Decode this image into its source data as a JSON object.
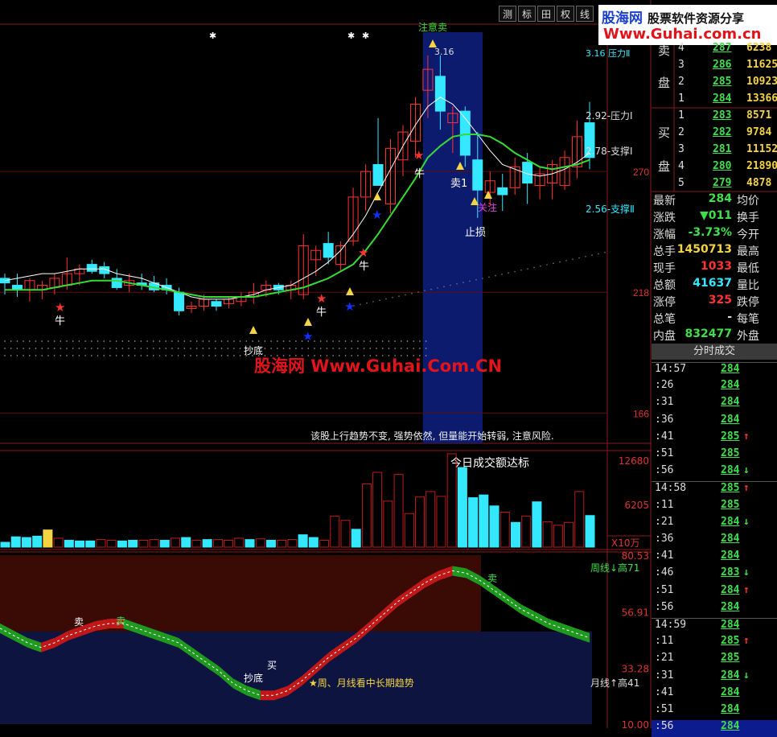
{
  "toolbar": {
    "buttons": [
      "测",
      "标",
      "田",
      "权",
      "线"
    ]
  },
  "watermark": {
    "brand": "股海网",
    "slogan": "股票软件资源分享",
    "url": "Www.Guhai.com.cn",
    "center_text": "股海网 Www.Guhai.Com.CN"
  },
  "colors": {
    "up": "#ff3333",
    "down": "#33e8ff",
    "ma_fast": "#ffffff",
    "ma_slow": "#33dd33",
    "highlight": "#0c1b6e",
    "accent_yellow": "#f4d442",
    "green": "#3ee04a"
  },
  "chart_data": [
    {
      "type": "candlestick",
      "y_ticks": [
        270,
        218,
        166
      ],
      "ylim": [
        155,
        330
      ],
      "candles": [
        {
          "o": 224,
          "h": 226,
          "l": 217,
          "c": 222
        },
        {
          "o": 221,
          "h": 226,
          "l": 216,
          "c": 219
        },
        {
          "o": 219,
          "h": 224,
          "l": 214,
          "c": 223
        },
        {
          "o": 219,
          "h": 223,
          "l": 215,
          "c": 221
        },
        {
          "o": 220,
          "h": 226,
          "l": 217,
          "c": 224
        },
        {
          "o": 221,
          "h": 233,
          "l": 219,
          "c": 226
        },
        {
          "o": 226,
          "h": 230,
          "l": 221,
          "c": 228
        },
        {
          "o": 230,
          "h": 232,
          "l": 226,
          "c": 227
        },
        {
          "o": 229,
          "h": 231,
          "l": 224,
          "c": 226
        },
        {
          "o": 224,
          "h": 228,
          "l": 219,
          "c": 220
        },
        {
          "o": 221,
          "h": 226,
          "l": 218,
          "c": 223
        },
        {
          "o": 222,
          "h": 226,
          "l": 219,
          "c": 221
        },
        {
          "o": 222,
          "h": 225,
          "l": 218,
          "c": 219
        },
        {
          "o": 221,
          "h": 224,
          "l": 217,
          "c": 219
        },
        {
          "o": 218,
          "h": 220,
          "l": 208,
          "c": 210
        },
        {
          "o": 211,
          "h": 214,
          "l": 209,
          "c": 212
        },
        {
          "o": 212,
          "h": 217,
          "l": 210,
          "c": 215
        },
        {
          "o": 214,
          "h": 215,
          "l": 210,
          "c": 212
        },
        {
          "o": 213,
          "h": 216,
          "l": 211,
          "c": 215
        },
        {
          "o": 214,
          "h": 218,
          "l": 212,
          "c": 216
        },
        {
          "o": 216,
          "h": 222,
          "l": 213,
          "c": 218
        },
        {
          "o": 219,
          "h": 223,
          "l": 216,
          "c": 221
        },
        {
          "o": 221,
          "h": 222,
          "l": 217,
          "c": 219
        },
        {
          "o": 219,
          "h": 223,
          "l": 215,
          "c": 221
        },
        {
          "o": 217,
          "h": 243,
          "l": 215,
          "c": 238
        },
        {
          "o": 232,
          "h": 238,
          "l": 225,
          "c": 236
        },
        {
          "o": 239,
          "h": 244,
          "l": 230,
          "c": 233
        },
        {
          "o": 230,
          "h": 240,
          "l": 227,
          "c": 238
        },
        {
          "o": 240,
          "h": 263,
          "l": 238,
          "c": 259
        },
        {
          "o": 259,
          "h": 273,
          "l": 253,
          "c": 270
        },
        {
          "o": 273,
          "h": 293,
          "l": 268,
          "c": 264
        },
        {
          "o": 256,
          "h": 284,
          "l": 252,
          "c": 280
        },
        {
          "o": 275,
          "h": 290,
          "l": 268,
          "c": 287
        },
        {
          "o": 283,
          "h": 302,
          "l": 276,
          "c": 299
        },
        {
          "o": 305,
          "h": 320,
          "l": 293,
          "c": 314
        },
        {
          "o": 311,
          "h": 320,
          "l": 288,
          "c": 296
        },
        {
          "o": 291,
          "h": 298,
          "l": 278,
          "c": 295
        },
        {
          "o": 296,
          "h": 298,
          "l": 272,
          "c": 277
        },
        {
          "o": 275,
          "h": 287,
          "l": 250,
          "c": 262
        },
        {
          "o": 261,
          "h": 270,
          "l": 255,
          "c": 266
        },
        {
          "o": 263,
          "h": 269,
          "l": 253,
          "c": 260
        },
        {
          "o": 263,
          "h": 276,
          "l": 260,
          "c": 272
        },
        {
          "o": 274,
          "h": 278,
          "l": 256,
          "c": 265
        },
        {
          "o": 264,
          "h": 272,
          "l": 258,
          "c": 269
        },
        {
          "o": 265,
          "h": 275,
          "l": 258,
          "c": 273
        },
        {
          "o": 264,
          "h": 279,
          "l": 262,
          "c": 276
        },
        {
          "o": 272,
          "h": 292,
          "l": 267,
          "c": 285
        },
        {
          "o": 291,
          "h": 300,
          "l": 271,
          "c": 276
        }
      ],
      "ma_fast": [
        223,
        224,
        225,
        226,
        226,
        227,
        228,
        228,
        228,
        226,
        225,
        224,
        222,
        220,
        218,
        216,
        215,
        215,
        215,
        216,
        217,
        219,
        220,
        221,
        224,
        227,
        231,
        236,
        243,
        251,
        261,
        271,
        281,
        290,
        298,
        302,
        299,
        293,
        286,
        279,
        273,
        271,
        269,
        268,
        269,
        271,
        274,
        278
      ],
      "ma_slow": [
        219,
        219,
        219,
        219,
        220,
        221,
        222,
        223,
        223,
        223,
        222,
        221,
        220,
        219,
        218,
        217,
        216,
        216,
        216,
        216,
        216,
        217,
        218,
        219,
        220,
        222,
        224,
        227,
        230,
        236,
        243,
        251,
        259,
        267,
        276,
        281,
        285,
        286,
        286,
        285,
        282,
        278,
        275,
        272,
        271,
        272,
        273,
        275
      ],
      "annotations": [
        "注意卖",
        "3.16",
        "3.16 压力Ⅱ",
        "2.92-压力Ⅰ",
        "2.78-支撑Ⅰ",
        "2.56-支撑Ⅱ",
        "卖1",
        "关注",
        "止损",
        "抄底",
        "牛",
        "牛",
        "牛",
        "牛"
      ],
      "note": "该股上行趋势不变, 强势依然, 但量能开始转弱, 注意风险."
    },
    {
      "type": "bar",
      "title": "今日成交额达标",
      "y_ticks": [
        12680,
        6205
      ],
      "unit": "X10万",
      "values": [
        700,
        1500,
        1400,
        1600,
        2500,
        1300,
        1000,
        900,
        900,
        1100,
        1000,
        900,
        1000,
        1000,
        1100,
        1000,
        1300,
        1400,
        1000,
        1100,
        1100,
        1000,
        1300,
        1100,
        1200,
        1000,
        1000,
        1100,
        1800,
        1400,
        1000,
        4500,
        3900,
        2600,
        9200,
        10900,
        6700,
        10600,
        4900,
        7300,
        8100,
        7400,
        13600,
        11600,
        7200,
        7600,
        6000,
        5100,
        3600,
        4500,
        6600,
        3700,
        3200,
        3600,
        8100,
        4600
      ],
      "colors": [
        "c",
        "c",
        "c",
        "c",
        "y",
        "r",
        "c",
        "c",
        "c",
        "r",
        "r",
        "c",
        "c",
        "r",
        "r",
        "c",
        "r",
        "c",
        "r",
        "c",
        "r",
        "r",
        "r",
        "c",
        "r",
        "c",
        "r",
        "r",
        "c",
        "c",
        "r",
        "r",
        "r",
        "c",
        "r",
        "r",
        "r",
        "r",
        "r",
        "r",
        "r",
        "r",
        "r",
        "c",
        "c",
        "c",
        "c",
        "r",
        "c",
        "r",
        "c",
        "r",
        "r",
        "r",
        "r",
        "c"
      ]
    },
    {
      "type": "line",
      "y_ticks": [
        80.53,
        56.91,
        33.28,
        10.0
      ],
      "labels": [
        "周线↓高71",
        "月线↑高41",
        "卖",
        "买",
        "卖",
        "抄底",
        "买",
        "卖"
      ],
      "legend": "★周、月线看中长期趋势",
      "values": [
        50,
        47,
        44,
        42,
        44,
        47,
        49,
        51,
        52,
        52,
        50,
        48,
        46,
        44,
        40,
        36,
        32,
        27,
        24,
        22,
        22,
        24,
        28,
        33,
        38,
        42,
        46,
        51,
        56,
        61,
        65,
        69,
        72,
        74,
        73,
        70,
        66,
        62,
        58,
        55,
        52,
        50,
        48,
        46
      ]
    }
  ],
  "orderbook": {
    "sell_label_a": "卖",
    "sell_label_b": "盘",
    "sells": [
      {
        "lvl": "4",
        "price": "287",
        "vol": "6238"
      },
      {
        "lvl": "3",
        "price": "286",
        "vol": "11625"
      },
      {
        "lvl": "2",
        "price": "285",
        "vol": "10923"
      },
      {
        "lvl": "1",
        "price": "284",
        "vol": "13366"
      }
    ],
    "buy_label_a": "买",
    "buy_label_b": "盘",
    "buys": [
      {
        "lvl": "1",
        "price": "283",
        "vol": "8571"
      },
      {
        "lvl": "2",
        "price": "282",
        "vol": "9784"
      },
      {
        "lvl": "3",
        "price": "281",
        "vol": "11152"
      },
      {
        "lvl": "4",
        "price": "280",
        "vol": "21890"
      },
      {
        "lvl": "5",
        "price": "279",
        "vol": "4878"
      }
    ]
  },
  "stats": [
    {
      "label": "最新",
      "value": "284",
      "color": "#3ee04a",
      "right": "均价"
    },
    {
      "label": "涨跌",
      "value": "▼011",
      "color": "#3ee04a",
      "right": "换手"
    },
    {
      "label": "涨幅",
      "value": "-3.73%",
      "color": "#3ee04a",
      "right": "今开"
    },
    {
      "label": "总手",
      "value": "1450713",
      "color": "#f4d442",
      "right": "最高"
    },
    {
      "label": "现手",
      "value": "1033",
      "color": "#ff3333",
      "right": "最低"
    },
    {
      "label": "总额",
      "value": "41637",
      "color": "#33e8ff",
      "right": "量比"
    },
    {
      "label": "涨停",
      "value": "325",
      "color": "#ff3333",
      "right": "跌停"
    },
    {
      "label": "总笔",
      "value": "-",
      "color": "#ddd",
      "right": "每笔"
    },
    {
      "label": "内盘",
      "value": "832477",
      "color": "#3ee04a",
      "right": "外盘"
    }
  ],
  "timesales": {
    "title": "分时成交",
    "rows": [
      {
        "t": "14:57",
        "p": "284",
        "a": ""
      },
      {
        "t": ":26",
        "p": "284",
        "a": ""
      },
      {
        "t": ":31",
        "p": "284",
        "a": ""
      },
      {
        "t": ":36",
        "p": "284",
        "a": ""
      },
      {
        "t": ":41",
        "p": "285",
        "a": "↑"
      },
      {
        "t": ":51",
        "p": "285",
        "a": ""
      },
      {
        "t": ":56",
        "p": "284",
        "a": "↓"
      },
      {
        "t": "14:58",
        "p": "285",
        "a": "↑"
      },
      {
        "t": ":11",
        "p": "285",
        "a": ""
      },
      {
        "t": ":21",
        "p": "284",
        "a": "↓"
      },
      {
        "t": ":36",
        "p": "284",
        "a": ""
      },
      {
        "t": ":41",
        "p": "284",
        "a": ""
      },
      {
        "t": ":46",
        "p": "283",
        "a": "↓"
      },
      {
        "t": ":51",
        "p": "284",
        "a": "↑"
      },
      {
        "t": ":56",
        "p": "284",
        "a": ""
      },
      {
        "t": "14:59",
        "p": "284",
        "a": ""
      },
      {
        "t": ":11",
        "p": "285",
        "a": "↑"
      },
      {
        "t": ":21",
        "p": "285",
        "a": ""
      },
      {
        "t": ":31",
        "p": "284",
        "a": "↓"
      },
      {
        "t": ":41",
        "p": "284",
        "a": ""
      },
      {
        "t": ":51",
        "p": "284",
        "a": ""
      },
      {
        "t": ":56",
        "p": "284",
        "a": ""
      }
    ]
  }
}
